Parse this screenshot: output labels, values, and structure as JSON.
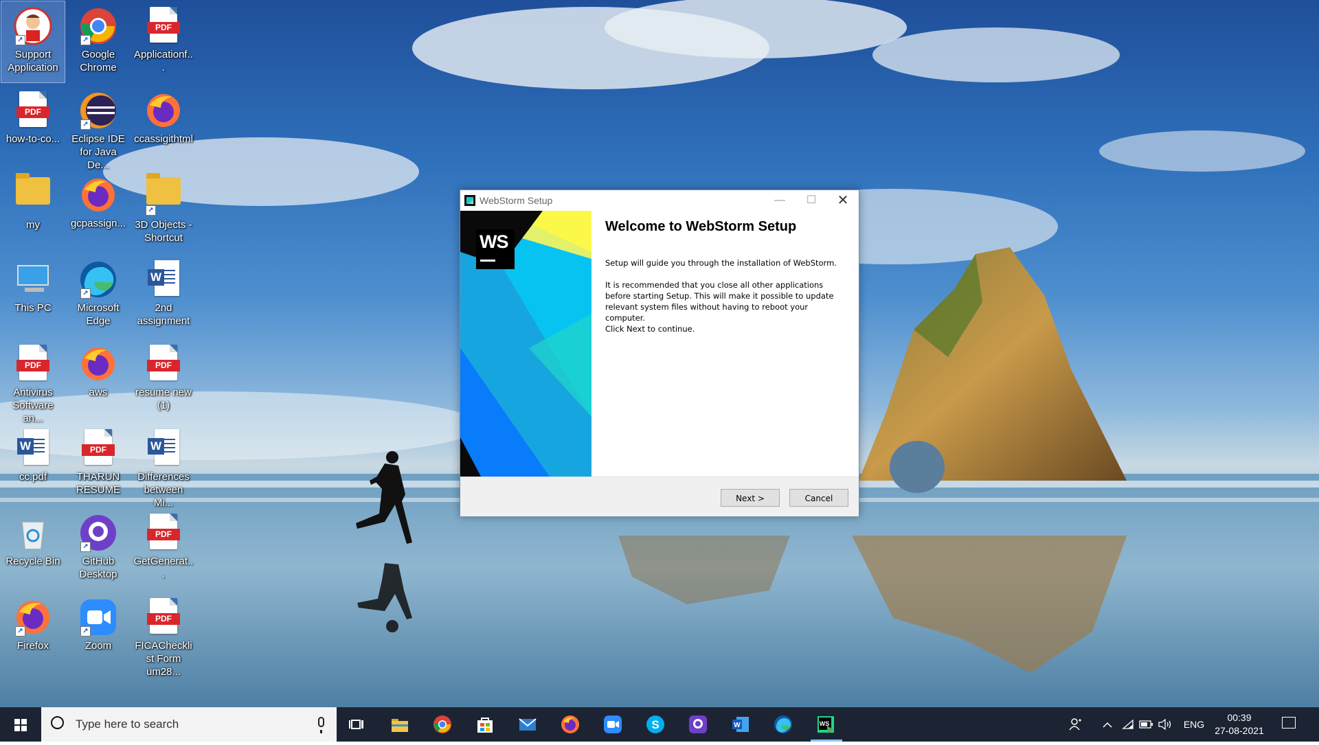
{
  "desktop": {
    "icons": [
      {
        "label": "Support Application"
      },
      {
        "label": "Google Chrome"
      },
      {
        "label": "Applicationf..."
      },
      {
        "label": "how-to-co..."
      },
      {
        "label": "Eclipse IDE for Java De..."
      },
      {
        "label": "ccassigithtml"
      },
      {
        "label": "my"
      },
      {
        "label": "gcpassign..."
      },
      {
        "label": "3D Objects - Shortcut"
      },
      {
        "label": "This PC"
      },
      {
        "label": "Microsoft Edge"
      },
      {
        "label": "2nd assignment"
      },
      {
        "label": "Antivirus Software an..."
      },
      {
        "label": "aws"
      },
      {
        "label": "resume new (1)"
      },
      {
        "label": "cc.pdf"
      },
      {
        "label": "THARUN RESUME"
      },
      {
        "label": "Differences between Mi..."
      },
      {
        "label": "Recycle Bin"
      },
      {
        "label": "GitHub Desktop"
      },
      {
        "label": "GetGenerat..."
      },
      {
        "label": "Firefox"
      },
      {
        "label": "Zoom"
      },
      {
        "label": "FICAChecklist Form um28..."
      }
    ],
    "pdf_tag": "PDF",
    "word_tag": "W"
  },
  "dialog": {
    "title": "WebStorm Setup",
    "logo_text": "WS",
    "heading": "Welcome to WebStorm Setup",
    "para1": "Setup will guide you through the installation of WebStorm.",
    "para2": "It is recommended that you close all other applications before starting Setup. This will make it possible to update relevant system files without having to reboot your computer.",
    "para3": "Click Next to continue.",
    "next_label": "Next >",
    "cancel_label": "Cancel",
    "minimize_glyph": "—",
    "maximize_glyph": "☐",
    "close_glyph": "✕"
  },
  "taskbar": {
    "search_placeholder": "Type here to search",
    "language": "ENG",
    "time": "00:39",
    "date": "27-08-2021",
    "pinned": [
      "task-view",
      "file-explorer",
      "chrome",
      "microsoft-store",
      "mail",
      "firefox",
      "zoom",
      "skype",
      "github",
      "word",
      "edge",
      "webstorm-installer"
    ]
  },
  "colors": {
    "taskbar": "#1c2433",
    "dialog_footer": "#f0f0f0",
    "pdf_red": "#d9262c",
    "word_blue": "#2b579a"
  }
}
